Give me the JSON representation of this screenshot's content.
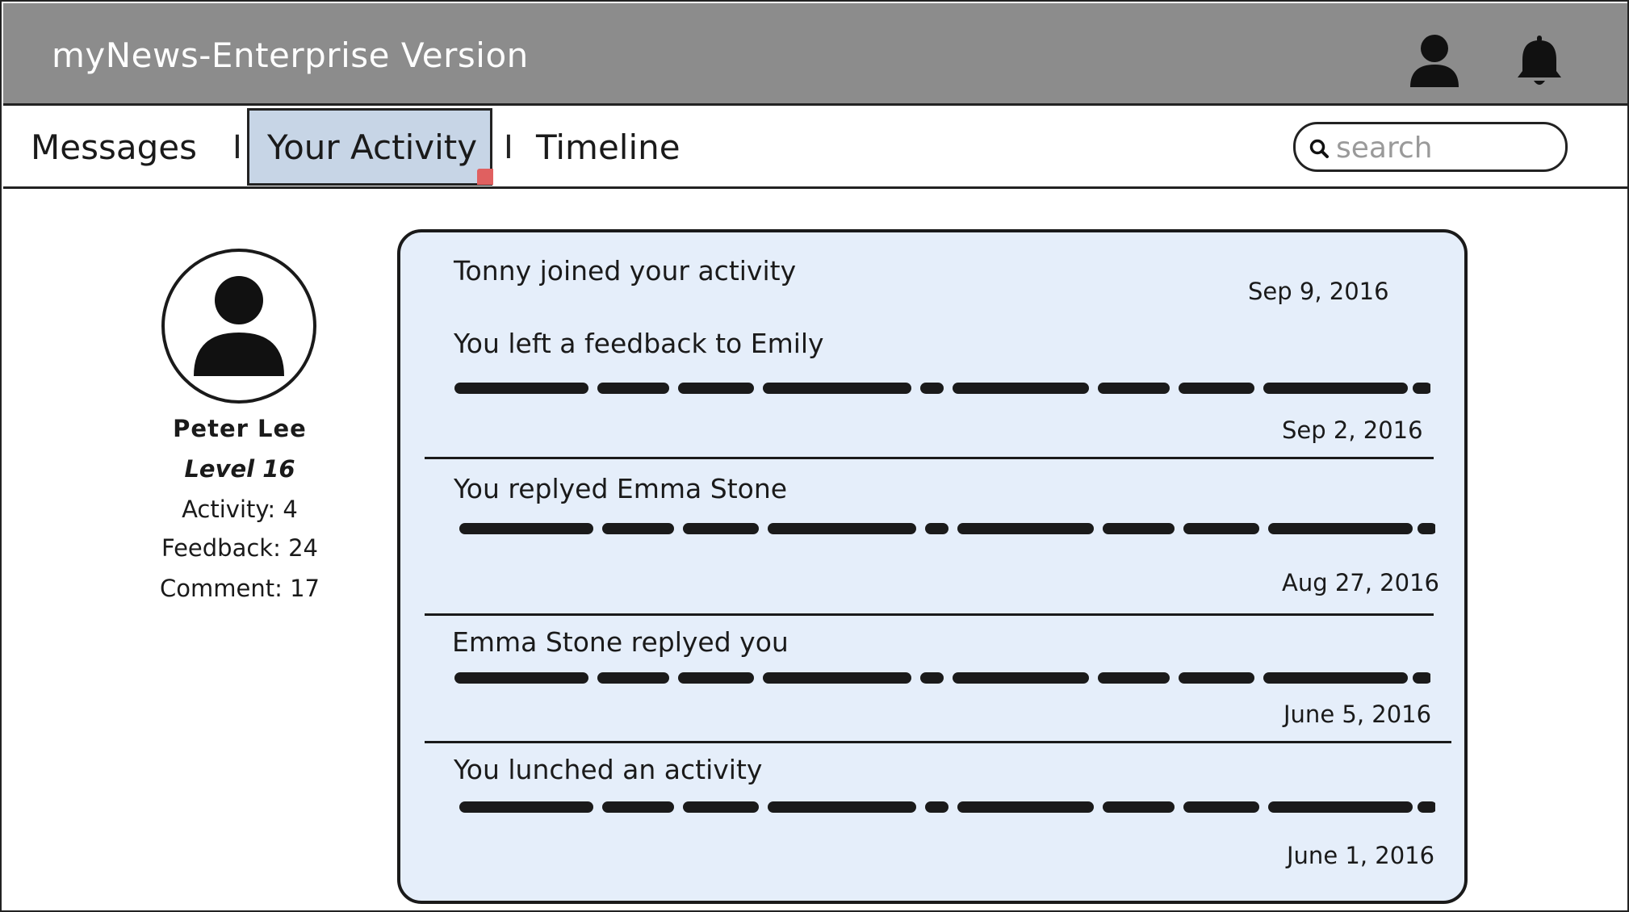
{
  "header": {
    "title": "myNews-Enterprise Version",
    "icons": [
      "user-icon",
      "bell-icon"
    ]
  },
  "nav": {
    "messages": "Messages",
    "separator": "I",
    "activity": "Your Activity",
    "timeline": "Timeline",
    "search_placeholder": "search"
  },
  "profile": {
    "name": "Peter Lee",
    "level": "Level 16",
    "activity": "Activity: 4",
    "feedback": "Feedback: 24",
    "comment": "Comment: 17"
  },
  "activities": [
    {
      "title": "Tonny joined your activity",
      "date": "Sep 9, 2016"
    },
    {
      "title": "You left a feedback to Emily",
      "date": "Sep 2, 2016"
    },
    {
      "title": "You replyed Emma Stone",
      "date": "Aug 27, 2016"
    },
    {
      "title": "Emma Stone replyed you",
      "date": "June 5, 2016"
    },
    {
      "title": "You lunched an activity",
      "date": "June 1, 2016"
    }
  ],
  "colors": {
    "header_bg": "#8c8c8c",
    "panel_bg": "#e5eefa",
    "active_tab_bg": "#c7d5e6"
  }
}
